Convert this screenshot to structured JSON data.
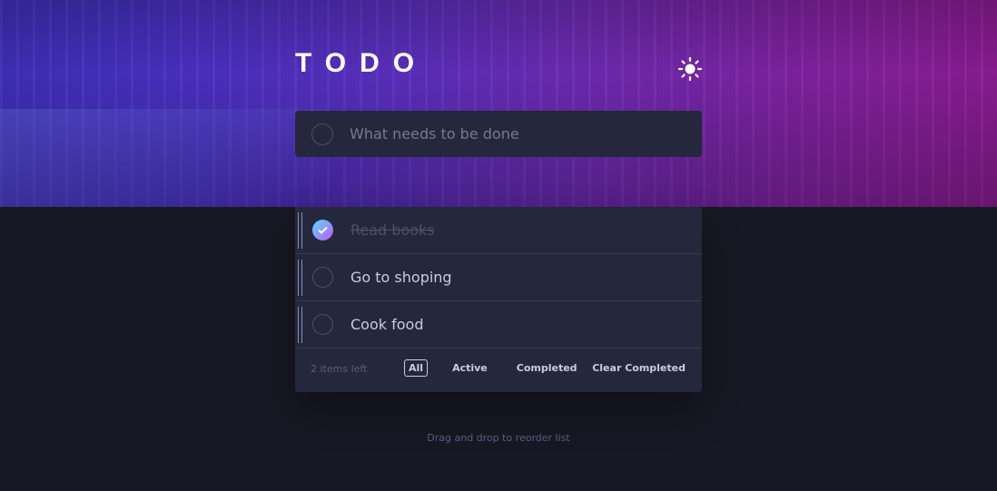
{
  "app": {
    "title": "TODO",
    "theme_toggle_icon": "sun-icon"
  },
  "new_todo": {
    "placeholder": "What needs to be done",
    "value": ""
  },
  "todos": [
    {
      "text": "Read books",
      "completed": true
    },
    {
      "text": "Go to shoping",
      "completed": false
    },
    {
      "text": "Cook food",
      "completed": false
    }
  ],
  "footer": {
    "items_left": "2 items left",
    "filters": [
      "All",
      "Active",
      "Completed"
    ],
    "active_filter": "All",
    "clear_label": "Clear Completed"
  },
  "hint": "Drag and drop to reorder list",
  "colors": {
    "background": "#171823",
    "card": "#25273d",
    "text": "#c8cbe7",
    "muted": "#5b5e7e",
    "check_gradient_start": "#55ddff",
    "check_gradient_end": "#c058f3"
  }
}
